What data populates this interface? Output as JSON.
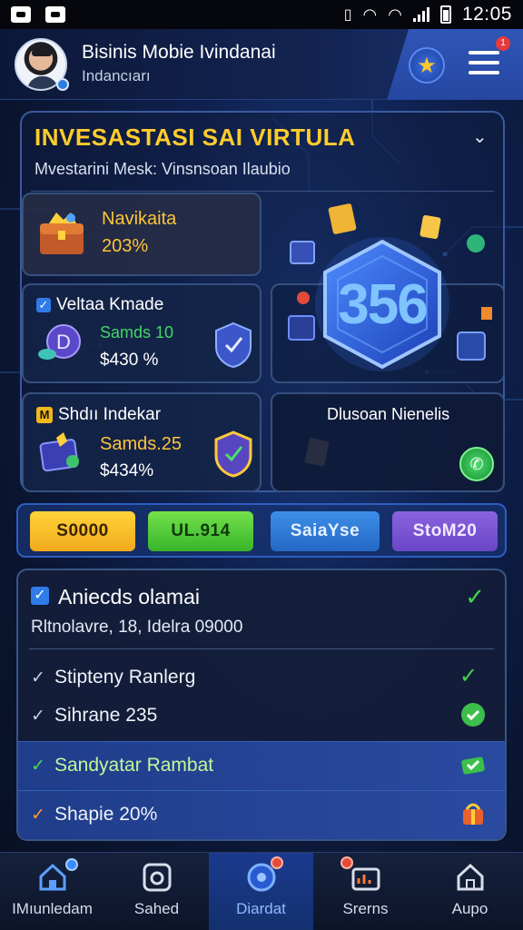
{
  "status_bar": {
    "time": "12:05"
  },
  "header": {
    "title": "Bisinis Mobie Ivindanai",
    "subtitle": "Indancıarı",
    "menu_badge": "1"
  },
  "hero": {
    "title": "INVESASTASI SAI VIRTULA",
    "description": "Mvestarini Mesk: Vinsnsoan Ilaubio",
    "badge_value": "356",
    "tiles": [
      {
        "name": "Navikaita",
        "value": "203%"
      },
      {
        "name": "Veltaa Kmade",
        "line1": "Samds 10",
        "line2": "$430 %"
      },
      {
        "name": "Shdıı Indekar",
        "line1": "Samds.25",
        "line2": "$434%"
      },
      {
        "name": "Dlusoan Nienelis"
      }
    ]
  },
  "actions": [
    {
      "label": "S0000",
      "color": "#f2a91b"
    },
    {
      "label": "UL.914",
      "color": "#38b52a"
    },
    {
      "label": "SaiaYse",
      "color": "#2467c4"
    },
    {
      "label": "StoM20",
      "color": "#6a46c6"
    }
  ],
  "list": {
    "title": "Aniecds olamai",
    "subtitle": "Rltnolavre, 18, Idelra 09000",
    "rows": [
      {
        "label": "Stipteny Ranlerg"
      },
      {
        "label": "Sihrane 235"
      },
      {
        "label": "Sandyatar Rambat"
      },
      {
        "label": "Shapie 20%"
      }
    ]
  },
  "nav": [
    {
      "label": "IMıunledam",
      "icon": "home-icon"
    },
    {
      "label": "Sahed",
      "icon": "camera-icon"
    },
    {
      "label": "Diardat",
      "icon": "dashboard-icon"
    },
    {
      "label": "Srerns",
      "icon": "chart-icon"
    },
    {
      "label": "Aupo",
      "icon": "house-icon"
    }
  ]
}
